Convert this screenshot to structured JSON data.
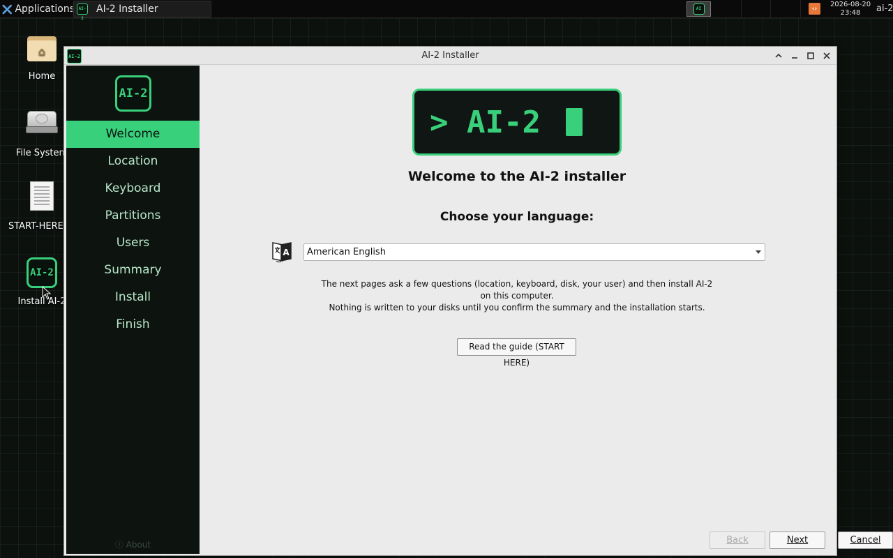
{
  "panel": {
    "applications_label": "Applications",
    "task_title": "AI-2 Installer",
    "clock_date": "2026-08-20",
    "clock_time": "23:48",
    "hostname": "ai-2"
  },
  "desktop": {
    "icons": [
      {
        "label": "Home"
      },
      {
        "label": "File System"
      },
      {
        "label": "START-HERE.txt"
      },
      {
        "label": "Install AI-2"
      }
    ]
  },
  "window": {
    "title": "AI-2 Installer",
    "icon_text": "AI-2"
  },
  "sidebar": {
    "logo_text": "AI-2",
    "steps": [
      {
        "label": "Welcome",
        "active": true
      },
      {
        "label": "Location"
      },
      {
        "label": "Keyboard"
      },
      {
        "label": "Partitions"
      },
      {
        "label": "Users"
      },
      {
        "label": "Summary"
      },
      {
        "label": "Install"
      },
      {
        "label": "Finish"
      }
    ],
    "about_label": "ⓘ About"
  },
  "main": {
    "hero_prompt": "> AI-2",
    "welcome_title": "Welcome to the AI-2 installer",
    "choose_language": "Choose your language:",
    "language_selected": "American English",
    "info_line1": "The next pages ask a few questions (location, keyboard, disk, your user) and then install AI-2 on this computer.",
    "info_line2": "Nothing is written to your disks until you confirm the summary and the installation starts.",
    "guide_button": "Read the guide (START HERE)"
  },
  "footer": {
    "back": "Back",
    "next": "Next",
    "cancel": "Cancel"
  },
  "colors": {
    "accent": "#39d07b",
    "sidebar_bg": "#0d1410",
    "desktop_bg": "#0c110e"
  }
}
